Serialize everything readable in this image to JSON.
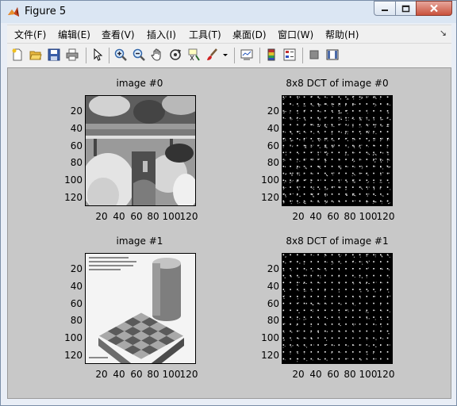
{
  "window": {
    "title": "Figure 5",
    "controls": {
      "minimize": "minimize",
      "maximize": "maximize",
      "close": "close"
    }
  },
  "menu": [
    "文件(F)",
    "编辑(E)",
    "查看(V)",
    "插入(I)",
    "工具(T)",
    "桌面(D)",
    "窗口(W)",
    "帮助(H)"
  ],
  "toolbar": {
    "icons": [
      "new-figure",
      "open-file",
      "save",
      "print",
      "pointer",
      "zoom-in",
      "zoom-out",
      "pan",
      "rotate-3d",
      "data-cursor",
      "brush",
      "link-plot",
      "colorbar",
      "legend",
      "hide-plot-tools",
      "show-plot-tools"
    ]
  },
  "figure": {
    "axes": [
      {
        "title": "image #0",
        "xticks": [
          "20",
          "40",
          "60",
          "80",
          "100",
          "120"
        ],
        "yticks": [
          "20",
          "40",
          "60",
          "80",
          "100",
          "120"
        ]
      },
      {
        "title": "8x8 DCT of image #0",
        "xticks": [
          "20",
          "40",
          "60",
          "80",
          "100",
          "120"
        ],
        "yticks": [
          "20",
          "40",
          "60",
          "80",
          "100",
          "120"
        ]
      },
      {
        "title": "image #1",
        "xticks": [
          "20",
          "40",
          "60",
          "80",
          "100",
          "120"
        ],
        "yticks": [
          "20",
          "40",
          "60",
          "80",
          "100",
          "120"
        ]
      },
      {
        "title": "8x8 DCT of image #1",
        "xticks": [
          "20",
          "40",
          "60",
          "80",
          "100",
          "120"
        ],
        "yticks": [
          "20",
          "40",
          "60",
          "80",
          "100",
          "120"
        ]
      }
    ]
  }
}
